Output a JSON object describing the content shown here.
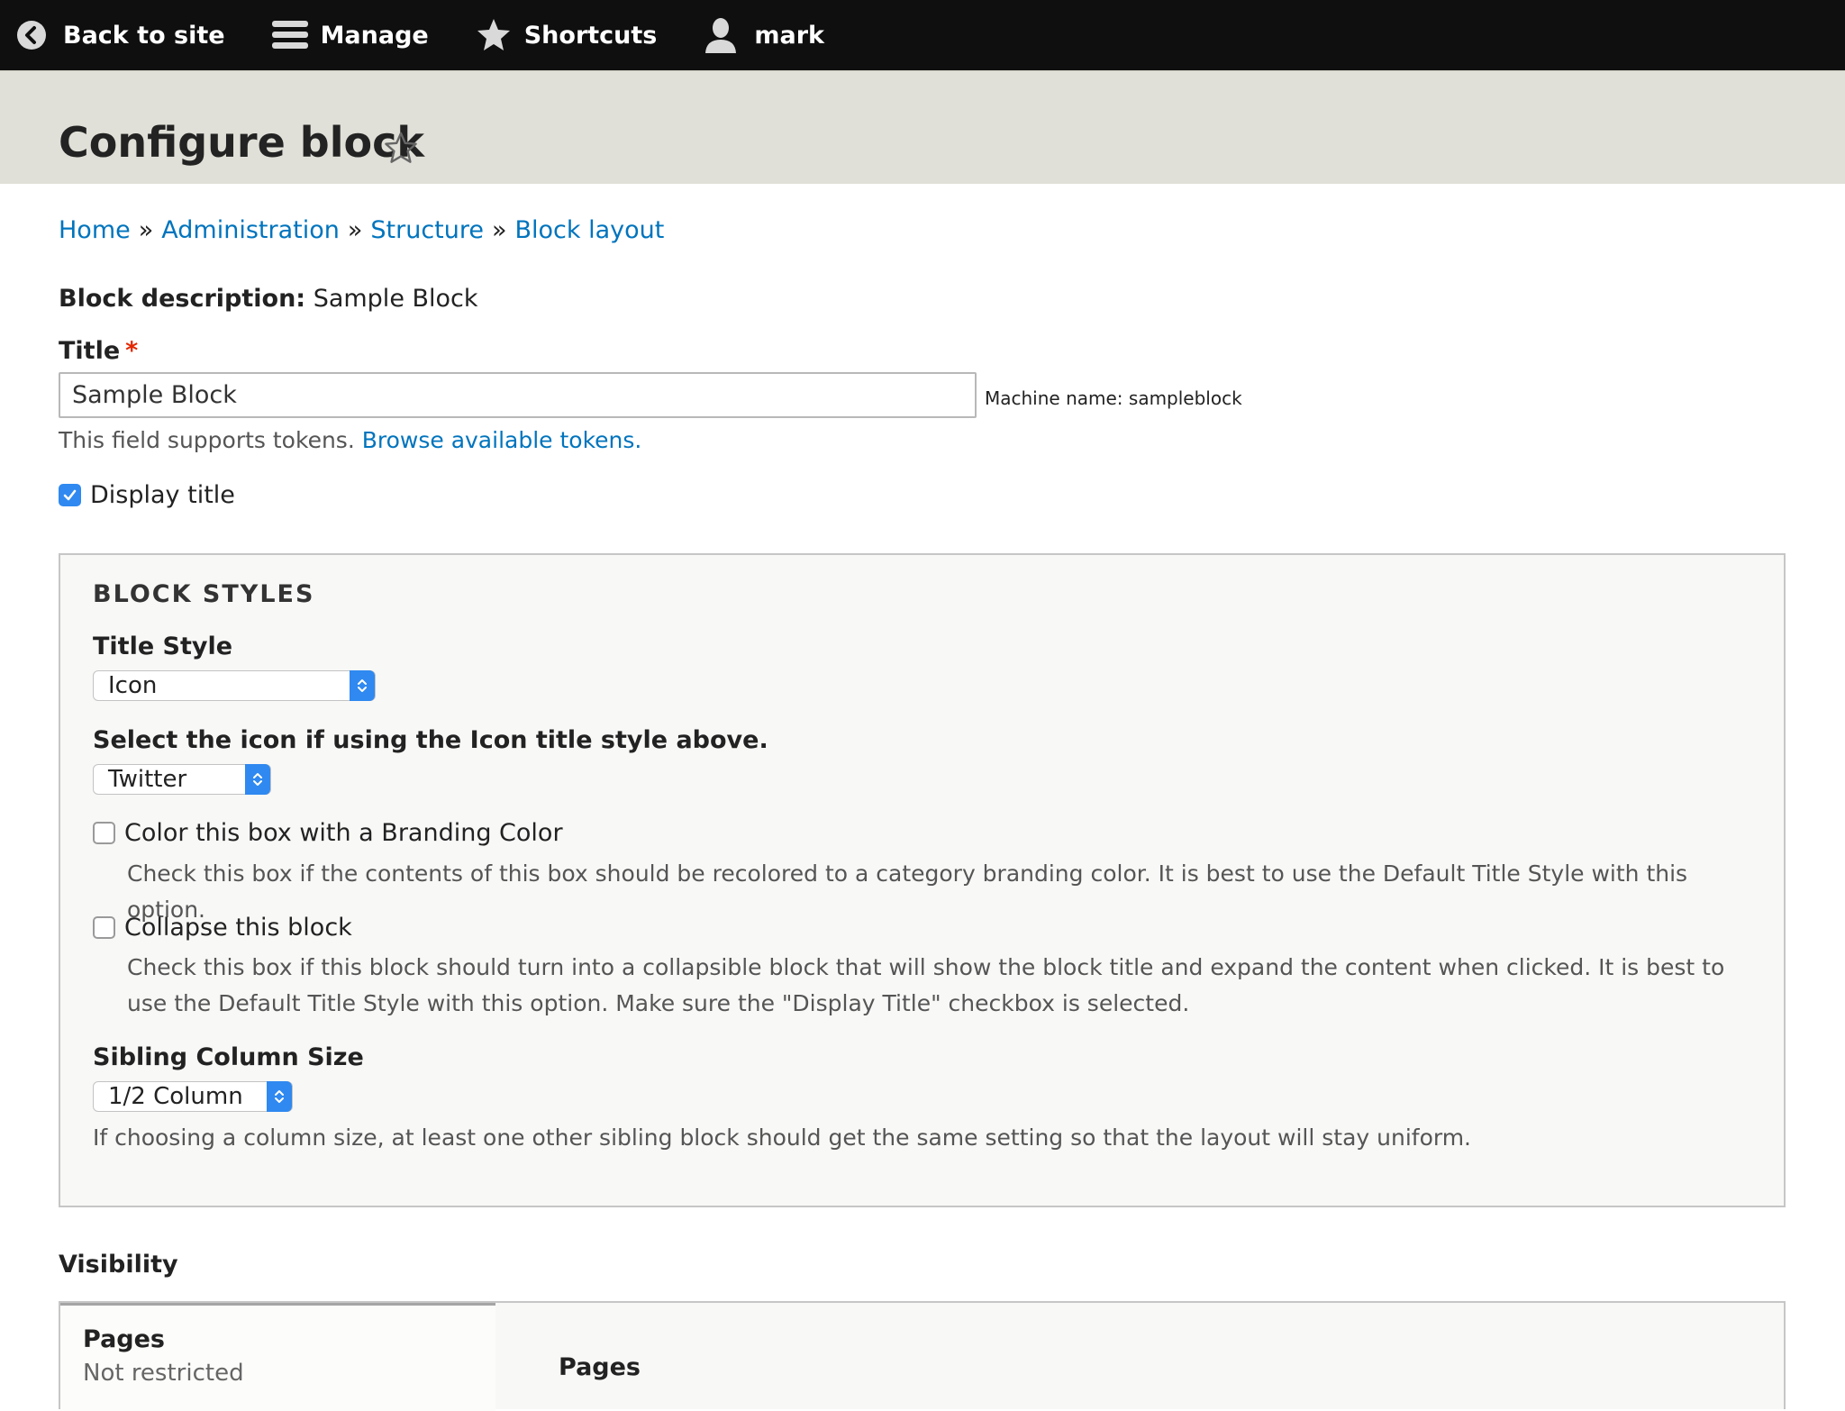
{
  "toolbar": {
    "back_label": "Back to site",
    "manage_label": "Manage",
    "shortcuts_label": "Shortcuts",
    "user_label": "mark"
  },
  "page": {
    "title": "Configure block"
  },
  "breadcrumb": {
    "items": [
      "Home",
      "Administration",
      "Structure",
      "Block layout"
    ],
    "separator": "»"
  },
  "form": {
    "block_description_label": "Block description:",
    "block_description_value": "Sample Block",
    "title_label": "Title",
    "required_marker": "*",
    "title_value": "Sample Block",
    "machine_name": "Machine name: sampleblock",
    "tokens_text": "This field supports tokens.",
    "tokens_link": "Browse available tokens.",
    "display_title_label": "Display title",
    "display_title_checked": true
  },
  "block_styles": {
    "legend": "BLOCK STYLES",
    "title_style_label": "Title Style",
    "title_style_value": "Icon",
    "icon_label": "Select the icon if using the Icon title style above.",
    "icon_value": "Twitter",
    "branding_label": "Color this box with a Branding Color",
    "branding_checked": false,
    "branding_desc": "Check this box if the contents of this box should be recolored to a category branding color. It is best to use the Default Title Style with this option.",
    "collapse_label": "Collapse this block",
    "collapse_checked": false,
    "collapse_desc": "Check this box if this block should turn into a collapsible block that will show the block title and expand the content when clicked. It is best to use the Default Title Style with this option. Make sure the \"Display Title\" checkbox is selected.",
    "sibling_label": "Sibling Column Size",
    "sibling_value": "1/2 Column",
    "sibling_desc": "If choosing a column size, at least one other sibling block should get the same setting so that the layout will stay uniform."
  },
  "visibility": {
    "label": "Visibility",
    "tab_title": "Pages",
    "tab_summary": "Not restricted",
    "pane_title": "Pages"
  },
  "colors": {
    "toolbar_bg": "#0f0f0f",
    "header_bg": "#e0e0d8",
    "link": "#0074bd",
    "accent": "#2f89f0",
    "required": "#e32700"
  }
}
